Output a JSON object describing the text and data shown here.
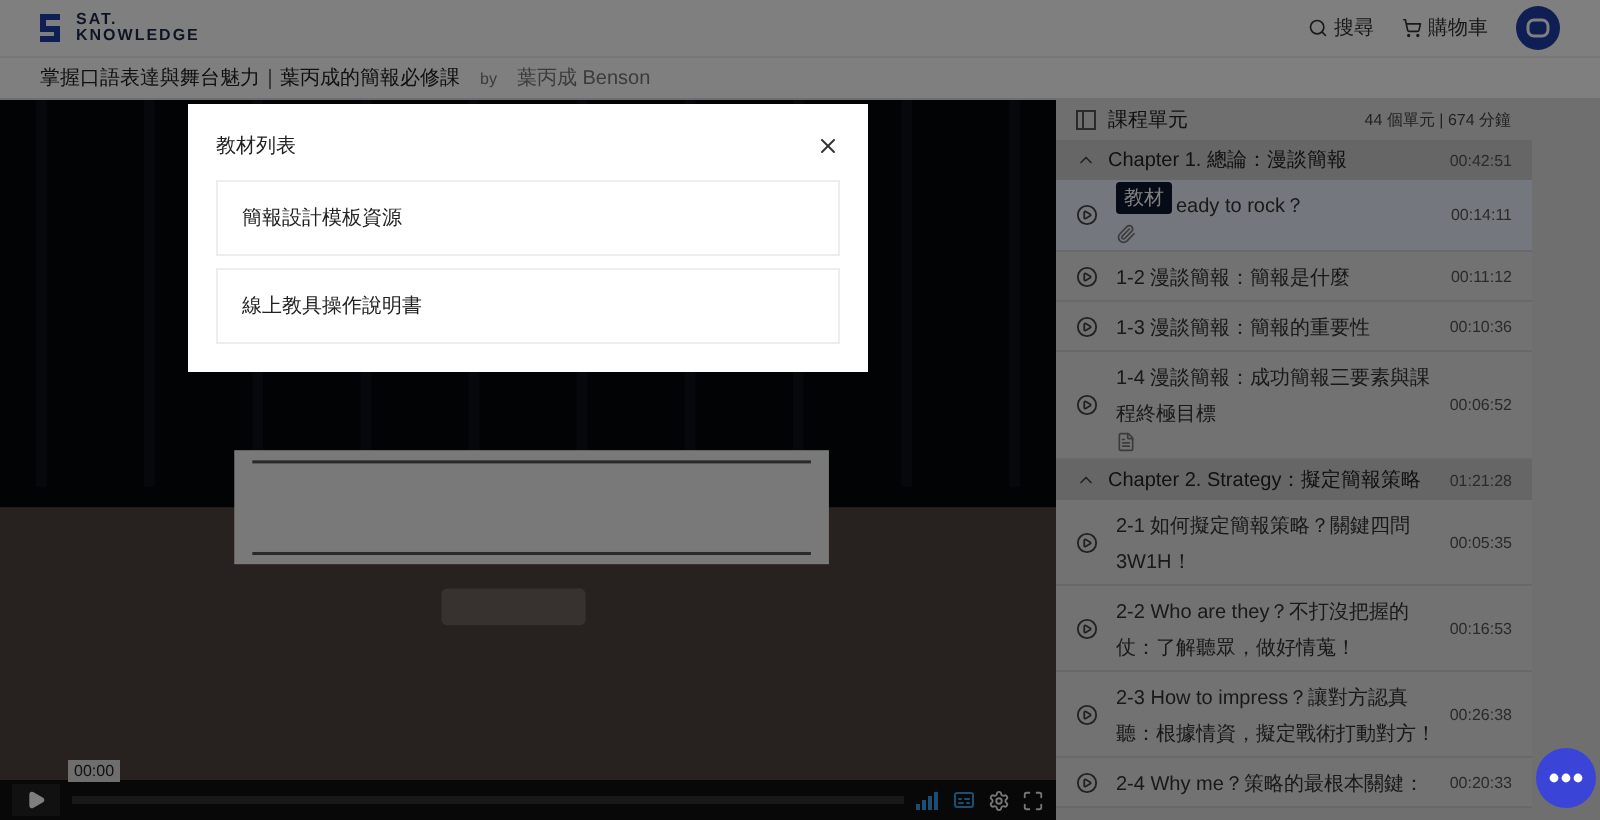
{
  "header": {
    "logo_lines": [
      "SAT.",
      "KNOWLEDGE"
    ],
    "nav": [
      {
        "label": "搜尋"
      },
      {
        "label": "購物車"
      }
    ]
  },
  "course": {
    "title": "掌握口語表達與舞台魅力｜葉丙成的簡報必修課",
    "by": "by",
    "author": "葉丙成 Benson"
  },
  "player": {
    "time": "00:00"
  },
  "sidebar": {
    "title": "課程單元",
    "summary": "44 個單元 | 674 分鐘",
    "chapters": [
      {
        "title": "Chapter 1. 總論：漫談簡報",
        "duration": "00:42:51",
        "expanded": true,
        "items": [
          {
            "title": "eady to rock？",
            "tooltip": "教材",
            "duration": "00:14:11",
            "selected": true,
            "kind": "material"
          },
          {
            "title": "1-2 漫談簡報：簡報是什麼",
            "duration": "00:11:12",
            "selected": false
          },
          {
            "title": "1-3 漫談簡報：簡報的重要性",
            "duration": "00:10:36",
            "selected": false
          },
          {
            "title": "1-4 漫談簡報：成功簡報三要素與課程終極目標",
            "duration": "00:06:52",
            "selected": false,
            "kind": "document"
          }
        ]
      },
      {
        "title": "Chapter 2. Strategy：擬定簡報策略",
        "duration": "01:21:28",
        "expanded": true,
        "items": [
          {
            "title": "2-1 如何擬定簡報策略？關鍵四問 3W1H！",
            "duration": "00:05:35",
            "selected": false
          },
          {
            "title": "2-2 Who are they？不打沒把握的仗：了解聽眾，做好情蒐！",
            "duration": "00:16:53",
            "selected": false
          },
          {
            "title": "2-3 How to impress？讓對方認真聽：根據情資，擬定戰術打動對方！",
            "duration": "00:26:38",
            "selected": false
          },
          {
            "title": "2-4 Why me？策略的最根本關鍵：",
            "duration": "00:20:33",
            "selected": false
          }
        ]
      }
    ]
  },
  "modal": {
    "title": "教材列表",
    "items": [
      "簡報設計模板資源",
      "線上教具操作說明書"
    ]
  }
}
